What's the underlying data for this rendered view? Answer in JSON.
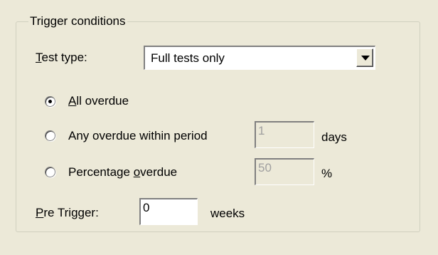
{
  "group": {
    "title": "Trigger conditions"
  },
  "test_type": {
    "label_prefix": "",
    "label_accel": "T",
    "label_rest": "est type:",
    "selected": "Full tests only"
  },
  "options": [
    {
      "label_prefix": "",
      "label_accel": "A",
      "label_rest": "ll overdue",
      "checked": true
    },
    {
      "label_prefix": "Any",
      "label_accel": "",
      "label_rest": " overdue within period",
      "checked": false,
      "value": "1",
      "unit": "days"
    },
    {
      "label_prefix": "Percentage ",
      "label_accel": "o",
      "label_rest": "verdue",
      "checked": false,
      "value": "50",
      "unit": "%"
    }
  ],
  "pre_trigger": {
    "label_prefix": "",
    "label_accel": "P",
    "label_rest": "re Trigger:",
    "value": "0",
    "unit": "weeks"
  }
}
